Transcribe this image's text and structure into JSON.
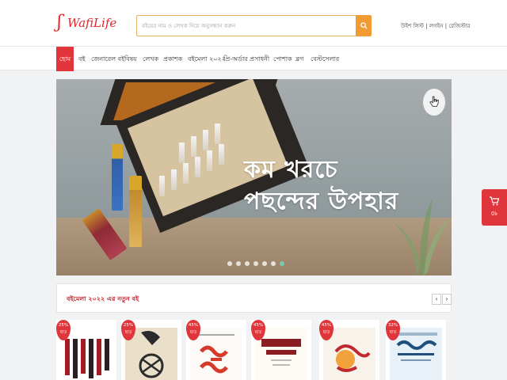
{
  "header": {
    "logo_text": "WafiLife",
    "search_placeholder": "বইয়ের নাম ও লেখক দিয়ে অনুসন্ধান করুন",
    "top_links": "উইশ লিস্ট | লগইন | রেজিস্টার"
  },
  "nav": {
    "items": [
      {
        "label": "হোম",
        "active": true
      },
      {
        "label": "বই",
        "active": false
      },
      {
        "label": "জেনারেল বই",
        "active": false
      },
      {
        "label": "বিষয়",
        "active": false
      },
      {
        "label": "লেখক",
        "active": false
      },
      {
        "label": "প্রকাশক",
        "active": false
      },
      {
        "label": "বইমেলা ২০২২",
        "active": false
      },
      {
        "label": "প্রি-অর্ডার",
        "active": false
      },
      {
        "label": "প্রসাধনী",
        "active": false
      },
      {
        "label": "পোশাক",
        "active": false
      },
      {
        "label": "ব্লগ",
        "active": false
      },
      {
        "label": "বেস্টসেলার",
        "active": false
      }
    ]
  },
  "banner": {
    "line1": "কম খরচে",
    "line2": "পছন্দের উপহার",
    "slide_count": 7,
    "active_slide": 7
  },
  "cart": {
    "count": "0৳"
  },
  "section": {
    "title": "বইমেলা ২০২২ এর নতুন বই",
    "prev": "‹",
    "next": "›"
  },
  "books": [
    {
      "discount": "25%",
      "suffix": "ছাড়"
    },
    {
      "discount": "25%",
      "suffix": "ছাড়"
    },
    {
      "discount": "45%",
      "suffix": "ছাড়"
    },
    {
      "discount": "45%",
      "suffix": "ছাড়"
    },
    {
      "discount": "45%",
      "suffix": "ছাড়"
    },
    {
      "discount": "32%",
      "suffix": "ছাড়"
    }
  ],
  "colors": {
    "brand_red": "#e0353b",
    "search_orange": "#f29b34"
  }
}
